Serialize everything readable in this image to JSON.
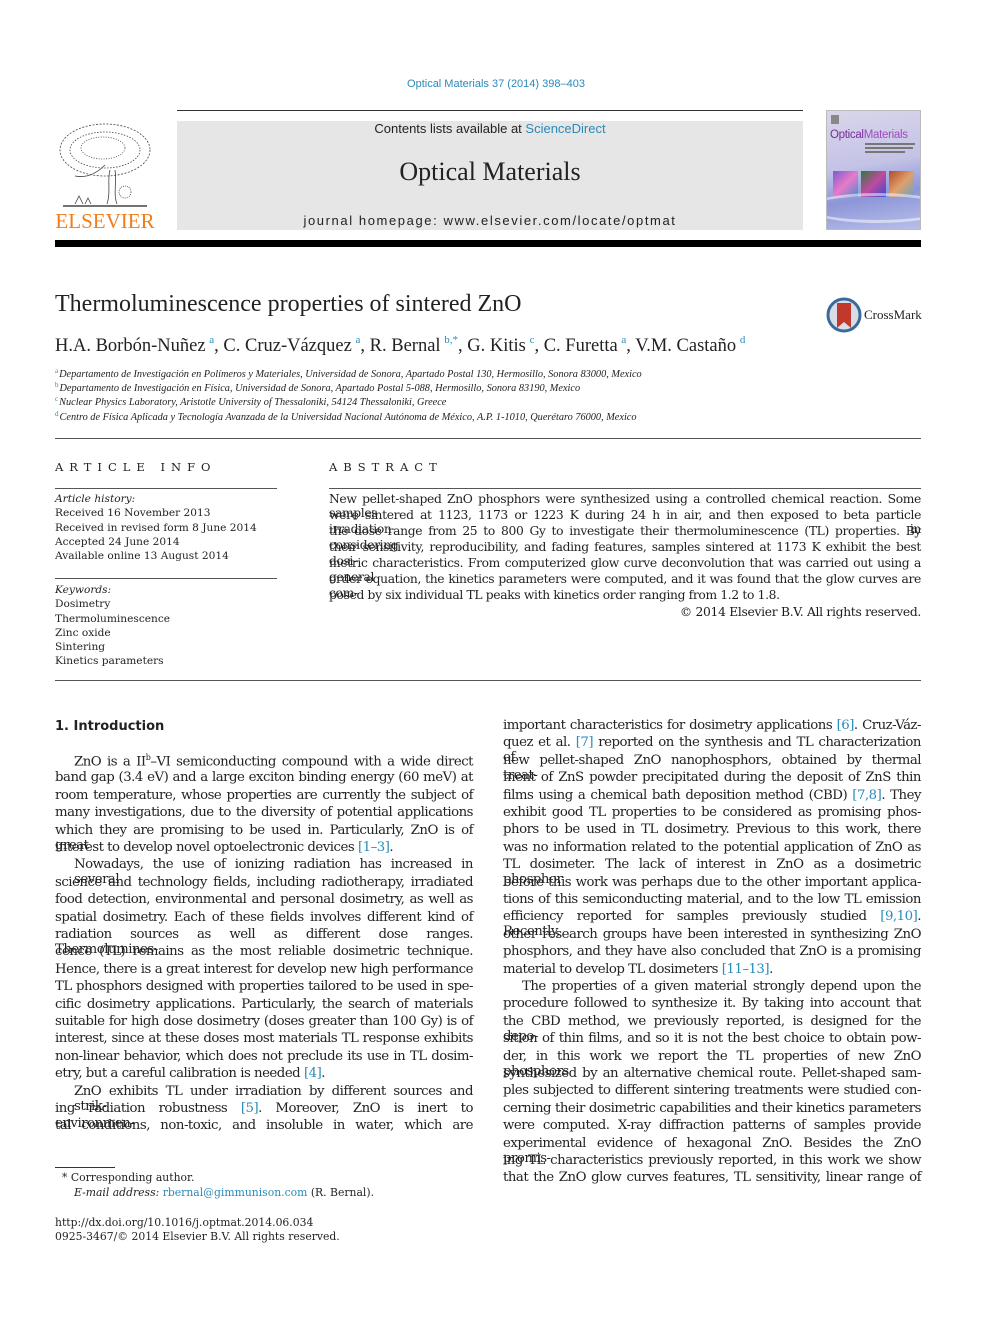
{
  "header": {
    "citation": "Optical Materials 37 (2014) 398–403",
    "contents_prefix": "Contents lists available at ",
    "contents_link": "ScienceDirect",
    "journal_title": "Optical Materials",
    "homepage": "journal homepage: www.elsevier.com/locate/optmat",
    "publisher_logo_text": "ELSEVIER",
    "cover": {
      "title_a": "Optical",
      "title_b": "Materials"
    }
  },
  "article": {
    "title": "Thermoluminescence properties of sintered ZnO",
    "crossmark_label": "CrossMark",
    "authors": [
      {
        "name": "H.A. Borbón-Nuñez",
        "sup": "a"
      },
      {
        "name": "C. Cruz-Vázquez",
        "sup": "a"
      },
      {
        "name": "R. Bernal",
        "sup": "b,*"
      },
      {
        "name": "G. Kitis",
        "sup": "c"
      },
      {
        "name": "C. Furetta",
        "sup": "a"
      },
      {
        "name": "V.M. Castaño",
        "sup": "d"
      }
    ],
    "affiliations": [
      {
        "key": "a",
        "text": "Departamento de Investigación en Polímeros y Materiales, Universidad de Sonora, Apartado Postal 130, Hermosillo, Sonora 83000, Mexico"
      },
      {
        "key": "b",
        "text": "Departamento de Investigación en Física, Universidad de Sonora, Apartado Postal 5-088, Hermosillo, Sonora 83190, Mexico"
      },
      {
        "key": "c",
        "text": "Nuclear Physics Laboratory, Aristotle University of Thessaloniki, 54124 Thessaloniki, Greece"
      },
      {
        "key": "d",
        "text": "Centro de Física Aplicada y Tecnología Avanzada de la Universidad Nacional Autónoma de México, A.P. 1-1010, Querétaro 76000, Mexico"
      }
    ]
  },
  "article_info": {
    "heading": "ARTICLE INFO",
    "history_label": "Article history:",
    "history": [
      "Received 16 November 2013",
      "Received in revised form 8 June 2014",
      "Accepted 24 June 2014",
      "Available online 13 August 2014"
    ],
    "keywords_label": "Keywords:",
    "keywords": [
      "Dosimetry",
      "Thermoluminescence",
      "Zinc oxide",
      "Sintering",
      "Kinetics parameters"
    ]
  },
  "abstract": {
    "heading": "ABSTRACT",
    "lines": [
      "New pellet-shaped ZnO phosphors were synthesized using a controlled chemical reaction. Some samples",
      "were sintered at 1123, 1173 or 1223 K during 24 h in air, and then exposed to beta particle irradiation in",
      "the dose range from 25 to 800 Gy to investigate their thermoluminescence (TL) properties. By considering",
      "their sensitivity, reproducibility, and fading features, samples sintered at 1173 K exhibit the best dosi-",
      "metric characteristics. From computerized glow curve deconvolution that was carried out using a general",
      "order equation, the kinetics parameters were computed, and it was found that the glow curves are com-",
      "posed by six individual TL peaks with kinetics order ranging from 1.2 to 1.8."
    ],
    "copyright": "© 2014 Elsevier B.V. All rights reserved."
  },
  "intro": {
    "heading": "1. Introduction",
    "left_column": [
      {
        "t": "ZnO is a II",
        "sup": "b",
        "t2": "–VI semiconducting compound with a wide direct",
        "indent": true
      },
      {
        "t": "band gap (3.4 eV) and a large exciton binding energy (60 meV) at"
      },
      {
        "t": "room temperature, whose properties are currently the subject of"
      },
      {
        "t": "many investigations, due to the diversity of potential applications"
      },
      {
        "t": "which they are promising to be used in. Particularly, ZnO is of great"
      },
      {
        "t": "interest to develop novel optoelectronic devices ",
        "ref": "[1–3]",
        "t2": ".",
        "last": true
      },
      {
        "t": "Nowadays, the use of ionizing radiation has increased in several",
        "indent": true
      },
      {
        "t": "science and technology fields, including radiotherapy, irradiated"
      },
      {
        "t": "food detection, environmental and personal dosimetry, as well as"
      },
      {
        "t": "spatial dosimetry. Each of these fields involves different kind of"
      },
      {
        "t": "radiation sources as well as different dose ranges. Thermolumines-"
      },
      {
        "t": "cence (TL) remains as the most reliable dosimetric technique."
      },
      {
        "t": "Hence, there is a great interest for develop new high performance"
      },
      {
        "t": "TL phosphors designed with properties tailored to be used in spe-"
      },
      {
        "t": "cific dosimetry applications. Particularly, the search of materials"
      },
      {
        "t": "suitable for high dose dosimetry (doses greater than 100 Gy) is of"
      },
      {
        "t": "interest, since at these doses most materials TL response exhibits"
      },
      {
        "t": "non-linear behavior, which does not preclude its use in TL dosim-"
      },
      {
        "t": "etry, but a careful calibration is needed ",
        "ref": "[4]",
        "t2": ".",
        "last": true
      },
      {
        "t": "ZnO exhibits TL under irradiation by different sources and strik-",
        "indent": true
      },
      {
        "t": "ing radiation robustness ",
        "ref": "[5]",
        "t2": ". Moreover, ZnO is inert to environmen-"
      },
      {
        "t": "tal conditions, non-toxic, and insoluble in water, which are"
      }
    ],
    "right_column": [
      {
        "t": "important characteristics for dosimetry applications ",
        "ref": "[6]",
        "t2": ". Cruz-Váz-"
      },
      {
        "t": "quez et al. ",
        "ref": "[7]",
        "t2": " reported on the synthesis and TL characterization of"
      },
      {
        "t": "new pellet-shaped ZnO nanophosphors, obtained by thermal treat-"
      },
      {
        "t": "ment of ZnS powder precipitated during the deposit of ZnS thin"
      },
      {
        "t": "films using a chemical bath deposition method (CBD) ",
        "ref": "[7,8]",
        "t2": ". They"
      },
      {
        "t": "exhibit good TL properties to be considered as promising phos-"
      },
      {
        "t": "phors to be used in TL dosimetry. Previous to this work, there"
      },
      {
        "t": "was no information related to the potential application of ZnO as"
      },
      {
        "t": "TL dosimeter. The lack of interest in ZnO as a dosimetric phosphor"
      },
      {
        "t": "before this work was perhaps due to the other important applica-"
      },
      {
        "t": "tions of this semiconducting material, and to the low TL emission"
      },
      {
        "t": "efficiency reported for samples previously studied ",
        "ref": "[9,10]",
        "t2": ". Recently,"
      },
      {
        "t": "other research groups have been interested in synthesizing ZnO"
      },
      {
        "t": "phosphors, and they have also concluded that ZnO is a promising"
      },
      {
        "t": "material to develop TL dosimeters ",
        "ref": "[11–13]",
        "t2": ".",
        "last": true
      },
      {
        "t": "The properties of a given material strongly depend upon the",
        "indent": true
      },
      {
        "t": "procedure followed to synthesize it. By taking into account that"
      },
      {
        "t": "the CBD method, we previously reported, is designed for the depo-"
      },
      {
        "t": "sition of thin films, and so it is not the best choice to obtain pow-"
      },
      {
        "t": "der, in this work we report the TL properties of new ZnO phosphors"
      },
      {
        "t": "synthesized by an alternative chemical route. Pellet-shaped sam-"
      },
      {
        "t": "ples subjected to different sintering treatments were studied con-"
      },
      {
        "t": "cerning their dosimetric capabilities and their kinetics parameters"
      },
      {
        "t": "were computed. X-ray diffraction patterns of samples provide"
      },
      {
        "t": "experimental evidence of hexagonal ZnO. Besides the ZnO promis-"
      },
      {
        "t": "ing TL characteristics previously reported, in this work we show"
      },
      {
        "t": "that the ZnO glow curves features, TL sensitivity, linear range of"
      }
    ]
  },
  "footnotes": {
    "corresponding": "* Corresponding author.",
    "email_label": "E-mail address: ",
    "email": "rbernal@gimmunison.com",
    "email_suffix": " (R. Bernal).",
    "doi": "http://dx.doi.org/10.1016/j.optmat.2014.06.034",
    "issn": "0925-3467/© 2014 Elsevier B.V. All rights reserved."
  },
  "colors": {
    "link": "#2a8ab8",
    "elsevier_orange": "#f07d1a",
    "masthead_bg": "#e6e6e6"
  }
}
